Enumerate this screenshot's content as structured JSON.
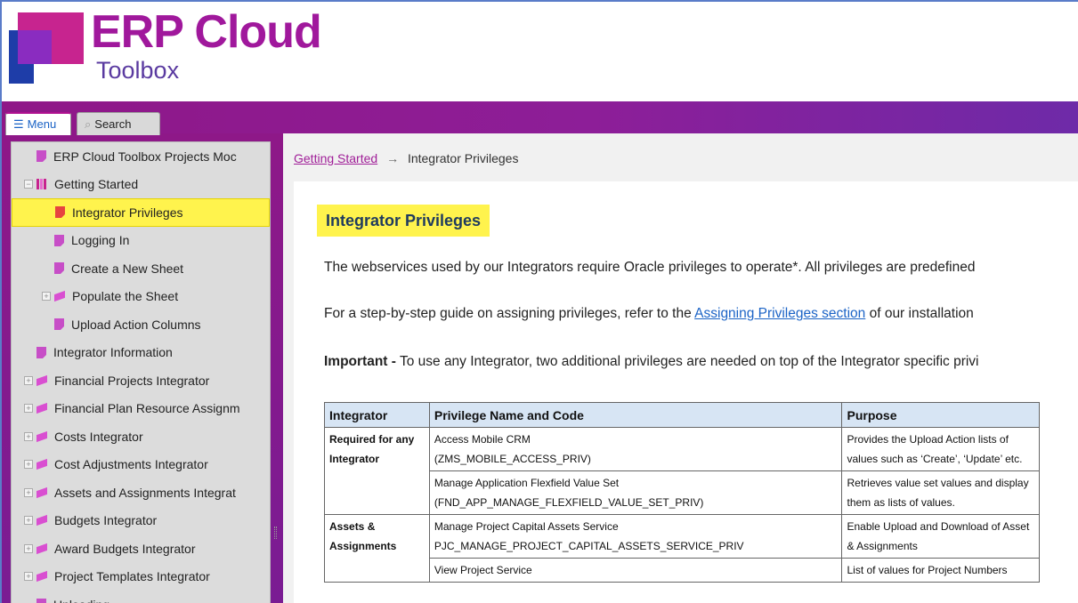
{
  "header": {
    "title": "ERP Cloud",
    "subtitle": "Toolbox",
    "brand_color": "#a0189c"
  },
  "tabs": [
    {
      "label": "Menu",
      "icon": "list-icon",
      "active": true
    },
    {
      "label": "Search",
      "icon": "search-icon",
      "active": false
    }
  ],
  "sidebar": {
    "items": [
      {
        "label": "ERP Cloud Toolbox Projects Moc",
        "icon": "page-icon",
        "indent": 0
      },
      {
        "label": "Getting Started",
        "icon": "open-book-icon",
        "indent": 0,
        "expander": "−"
      },
      {
        "label": "Integrator Privileges",
        "icon": "page-icon",
        "indent": 1,
        "active": true
      },
      {
        "label": "Logging In",
        "icon": "page-icon",
        "indent": 1
      },
      {
        "label": "Create a New Sheet",
        "icon": "page-icon",
        "indent": 1
      },
      {
        "label": "Populate the Sheet",
        "icon": "book-icon",
        "indent": 1,
        "expander": "+"
      },
      {
        "label": "Upload Action Columns",
        "icon": "page-icon",
        "indent": 1
      },
      {
        "label": "Integrator Information",
        "icon": "page-icon",
        "indent": 0
      },
      {
        "label": "Financial Projects Integrator",
        "icon": "book-icon",
        "indent": 0,
        "expander": "+"
      },
      {
        "label": "Financial Plan Resource Assignm",
        "icon": "book-icon",
        "indent": 0,
        "expander": "+"
      },
      {
        "label": "Costs Integrator",
        "icon": "book-icon",
        "indent": 0,
        "expander": "+"
      },
      {
        "label": "Cost Adjustments Integrator",
        "icon": "book-icon",
        "indent": 0,
        "expander": "+"
      },
      {
        "label": "Assets and Assignments Integrat",
        "icon": "book-icon",
        "indent": 0,
        "expander": "+"
      },
      {
        "label": "Budgets Integrator",
        "icon": "book-icon",
        "indent": 0,
        "expander": "+"
      },
      {
        "label": "Award Budgets Integrator",
        "icon": "book-icon",
        "indent": 0,
        "expander": "+"
      },
      {
        "label": "Project Templates Integrator",
        "icon": "book-icon",
        "indent": 0,
        "expander": "+"
      },
      {
        "label": "Uploading",
        "icon": "page-icon",
        "indent": 0
      }
    ]
  },
  "breadcrumb": {
    "parent": "Getting Started",
    "separator": "→",
    "current": "Integrator Privileges"
  },
  "main": {
    "heading": "Integrator Privileges",
    "para1": "The webservices used by our Integrators require Oracle privileges to operate*. All privileges are predefined",
    "para2_before": "For a step-by-step guide on assigning privileges, refer to the ",
    "para2_link": "Assigning Privileges section",
    "para2_after": " of our installation",
    "para3_bold": "Important -",
    "para3_rest": " To use any Integrator, two additional privileges are needed on top of the Integrator specific privi"
  },
  "table": {
    "headers": [
      "Integrator",
      "Privilege Name and Code",
      "Purpose"
    ],
    "rows": [
      {
        "group": "Required for any Integrator",
        "privilege": "Access Mobile CRM",
        "code": "(ZMS_MOBILE_ACCESS_PRIV)",
        "purpose": "Provides the Upload Action lists of values such as ‘Create’, ‘Update’ etc."
      },
      {
        "group": "",
        "privilege": "Manage Application Flexfield Value Set",
        "code": "(FND_APP_MANAGE_FLEXFIELD_VALUE_SET_PRIV)",
        "purpose": "Retrieves value set values and display them as lists of values."
      },
      {
        "group": "Assets & Assignments",
        "privilege": "Manage Project Capital Assets Service",
        "code": "PJC_MANAGE_PROJECT_CAPITAL_ASSETS_SERVICE_PRIV",
        "purpose": "Enable Upload and Download of Asset & Assignments"
      },
      {
        "group": "",
        "privilege": "View Project Service",
        "code": "",
        "purpose": "List of values for Project Numbers"
      }
    ]
  }
}
